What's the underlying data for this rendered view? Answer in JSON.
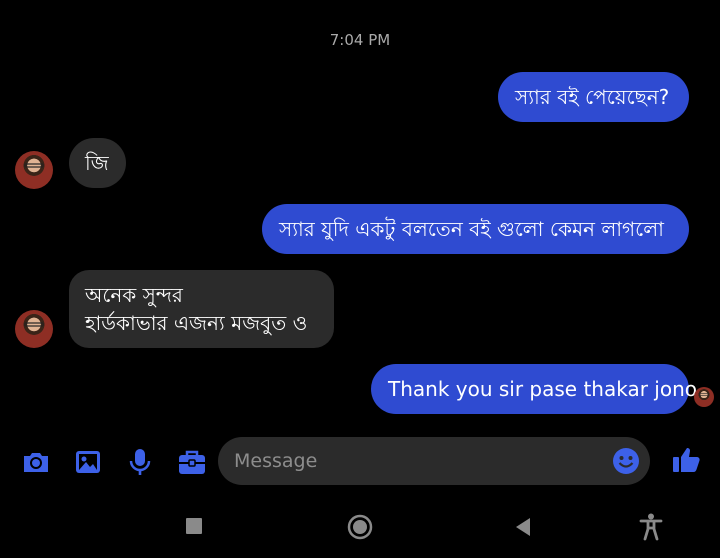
{
  "conversation": {
    "timestamp": "7:04 PM",
    "messages": [
      {
        "direction": "sent",
        "text": "স্যার বই পেয়েছেন?"
      },
      {
        "direction": "received",
        "text": "জি"
      },
      {
        "direction": "sent",
        "text": "স্যার যুদি একটু বলতেন বই গুলো কেমন লাগলো"
      },
      {
        "direction": "received",
        "lines": [
          "অনেক সুন্দর",
          "হার্ডকাভার এজন্য মজবুত ও"
        ]
      },
      {
        "direction": "sent",
        "text": "Thank you sir pase thakar jono"
      }
    ]
  },
  "composer": {
    "placeholder": "Message",
    "tools": [
      "camera-icon",
      "gallery-icon",
      "microphone-icon",
      "briefcase-icon"
    ],
    "emoji_icon": "smiley-icon",
    "like_icon": "thumbs-up-icon"
  },
  "navbar": [
    "recent-apps-icon",
    "home-icon",
    "back-icon",
    "accessibility-icon"
  ],
  "colors": {
    "sent_bubble": "#2f4bd1",
    "received_bubble": "#2b2b2b",
    "accent": "#3d61e8",
    "background": "#000000"
  }
}
